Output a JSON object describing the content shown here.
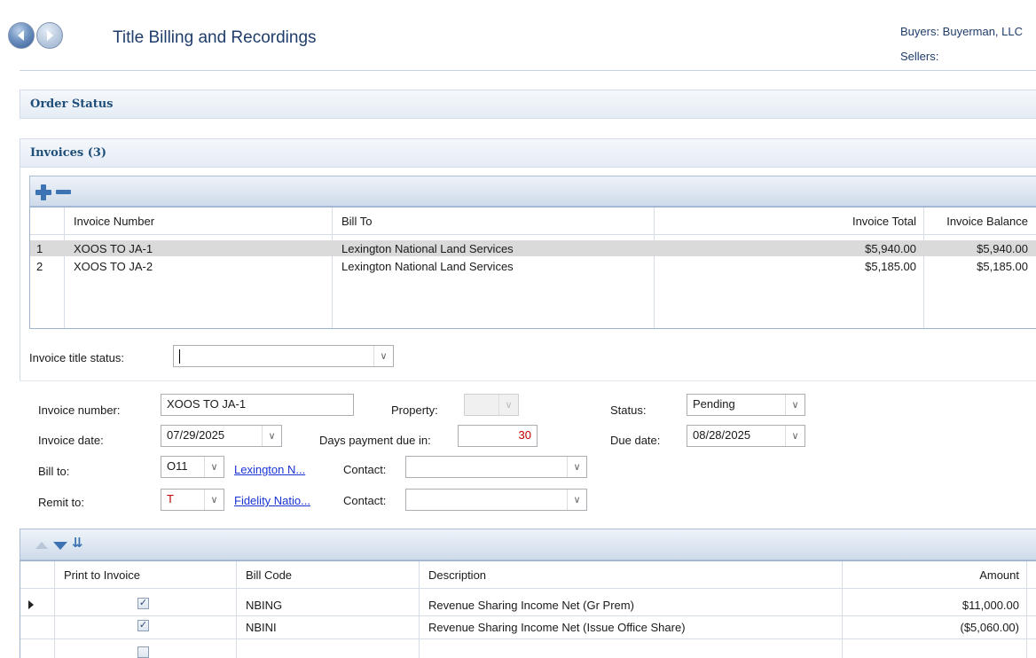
{
  "header": {
    "title": "Title Billing and Recordings",
    "buyers": "Buyers: Buyerman, LLC",
    "sellers": "Sellers:"
  },
  "sections": {
    "order_status": "Order Status",
    "invoices": "Invoices (3)"
  },
  "invoices": {
    "columns": [
      "",
      "Invoice Number",
      "Bill To",
      "",
      "Invoice Total",
      "Invoice Balance"
    ],
    "rows": [
      {
        "num": "1",
        "invoice_number": "XOOS TO JA-1",
        "bill_to": "Lexington National Land Services",
        "total": "$5,940.00",
        "balance": "$5,940.00"
      },
      {
        "num": "2",
        "invoice_number": "XOOS TO JA-2",
        "bill_to": "Lexington National Land Services",
        "total": "$5,185.00",
        "balance": "$5,185.00"
      }
    ]
  },
  "title_status": {
    "label": "Invoice title status:",
    "value": ""
  },
  "form": {
    "invoice_number_label": "Invoice number:",
    "invoice_number": "XOOS TO JA-1",
    "property_label": "Property:",
    "property": "",
    "status_label": "Status:",
    "status": "Pending",
    "invoice_date_label": "Invoice date:",
    "invoice_date": "07/29/2025",
    "days_due_label": "Days payment due in:",
    "days_due": "30",
    "due_date_label": "Due date:",
    "due_date": "08/28/2025",
    "bill_to_label": "Bill to:",
    "bill_to_code": "O11",
    "bill_to_link": "Lexington N...",
    "contact_label": "Contact:",
    "bill_contact": "",
    "remit_to_label": "Remit to:",
    "remit_to_code": "T",
    "remit_to_link": "Fidelity Natio...",
    "remit_contact": ""
  },
  "bill_codes": {
    "columns": [
      "Print to Invoice",
      "Bill Code",
      "Description",
      "Amount"
    ],
    "rows": [
      {
        "print": true,
        "code": "NBING",
        "description": "Revenue Sharing Income Net (Gr Prem)",
        "amount": "$11,000.00"
      },
      {
        "print": true,
        "code": "NBINI",
        "description": "Revenue Sharing Income Net (Issue Office Share)",
        "amount": "($5,060.00)"
      }
    ]
  },
  "colors": {
    "accent": "#1f4e79",
    "link": "#1a33d6",
    "toolbar_icon": "#3d73b3",
    "required_text": "#c00000"
  }
}
